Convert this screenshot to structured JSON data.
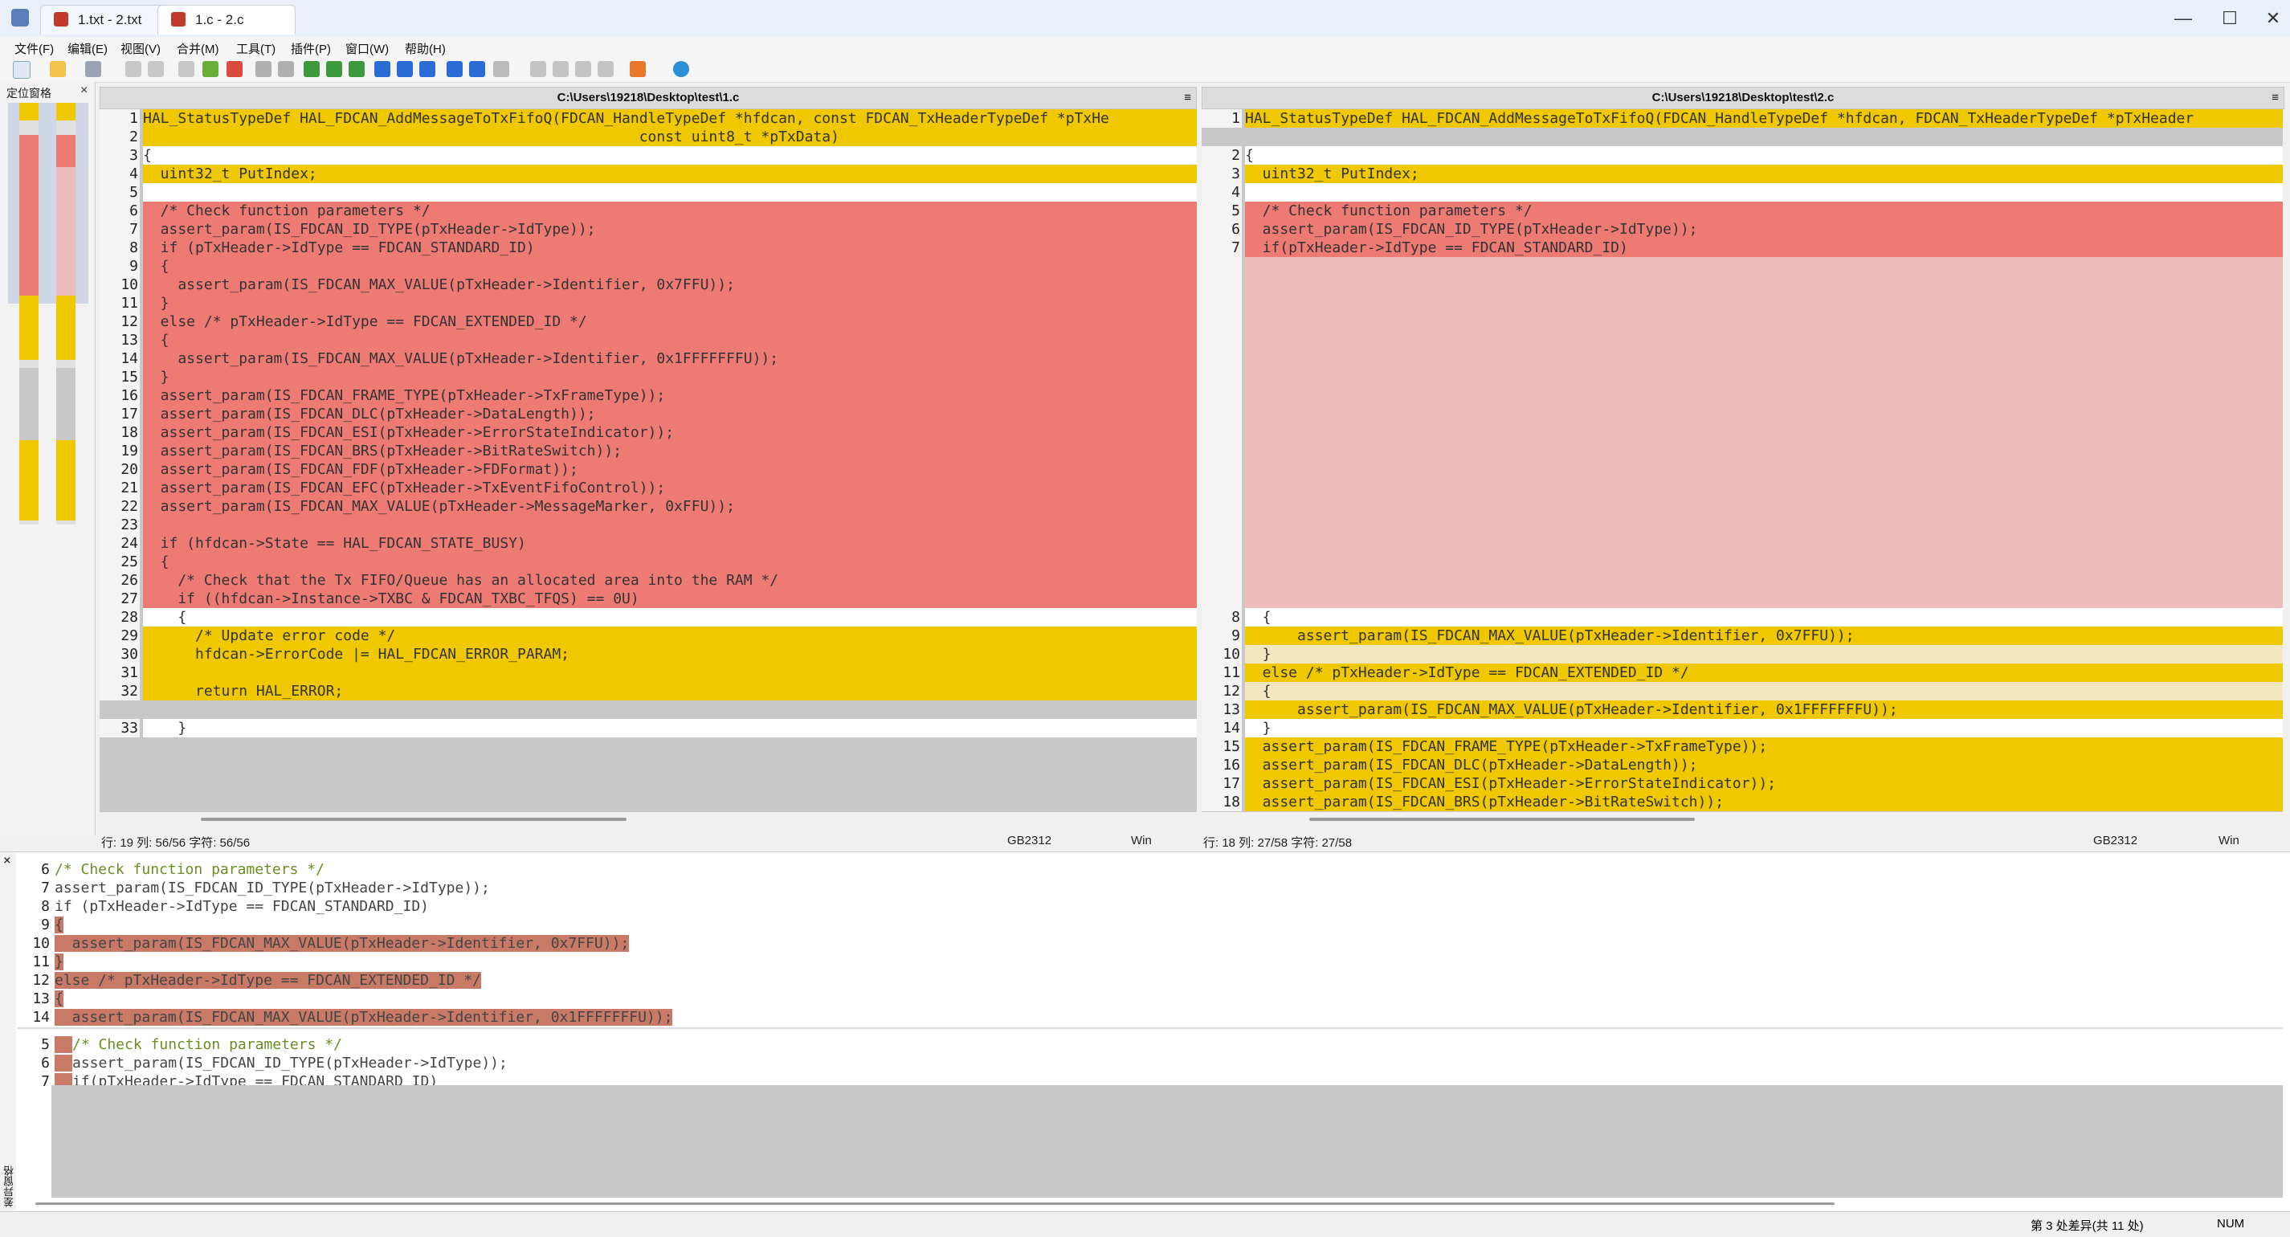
{
  "window": {
    "tabs": [
      {
        "label": "1.txt - 2.txt"
      },
      {
        "label": "1.c - 2.c"
      }
    ],
    "controls": [
      "—",
      "☐",
      "✕"
    ]
  },
  "menu": [
    "文件(F)",
    "编辑(E)",
    "视图(V)",
    "合并(M)",
    "工具(T)",
    "插件(P)",
    "窗口(W)",
    "帮助(H)"
  ],
  "locator": {
    "title": "定位窗格",
    "close": "×"
  },
  "left_pane": {
    "path": "C:\\Users\\19218\\Desktop\\test\\1.c",
    "menu_icon": "≡",
    "lines": [
      {
        "n": "1",
        "t": "HAL_StatusTypeDef HAL_FDCAN_AddMessageToTxFifoQ(FDCAN_HandleTypeDef *hfdcan, const FDCAN_TxHeaderTypeDef *pTxHe",
        "c": "yellow"
      },
      {
        "n": "2",
        "t": "                                                         const uint8_t *pTxData)",
        "c": "yellow"
      },
      {
        "n": "3",
        "t": "{",
        "c": "white"
      },
      {
        "n": "4",
        "t": "  uint32_t PutIndex;",
        "c": "yellow"
      },
      {
        "n": "5",
        "t": "",
        "c": "white"
      },
      {
        "n": "6",
        "t": "  /* Check function parameters */",
        "c": "red"
      },
      {
        "n": "7",
        "t": "  assert_param(IS_FDCAN_ID_TYPE(pTxHeader->IdType));",
        "c": "red"
      },
      {
        "n": "8",
        "t": "  if (pTxHeader->IdType == FDCAN_STANDARD_ID)",
        "c": "red"
      },
      {
        "n": "9",
        "t": "  {",
        "c": "red"
      },
      {
        "n": "10",
        "t": "    assert_param(IS_FDCAN_MAX_VALUE(pTxHeader->Identifier, 0x7FFU));",
        "c": "red"
      },
      {
        "n": "11",
        "t": "  }",
        "c": "red"
      },
      {
        "n": "12",
        "t": "  else /* pTxHeader->IdType == FDCAN_EXTENDED_ID */",
        "c": "red"
      },
      {
        "n": "13",
        "t": "  {",
        "c": "red"
      },
      {
        "n": "14",
        "t": "    assert_param(IS_FDCAN_MAX_VALUE(pTxHeader->Identifier, 0x1FFFFFFFU));",
        "c": "red"
      },
      {
        "n": "15",
        "t": "  }",
        "c": "red"
      },
      {
        "n": "16",
        "t": "  assert_param(IS_FDCAN_FRAME_TYPE(pTxHeader->TxFrameType));",
        "c": "red"
      },
      {
        "n": "17",
        "t": "  assert_param(IS_FDCAN_DLC(pTxHeader->DataLength));",
        "c": "red"
      },
      {
        "n": "18",
        "t": "  assert_param(IS_FDCAN_ESI(pTxHeader->ErrorStateIndicator));",
        "c": "red"
      },
      {
        "n": "19",
        "t": "  assert_param(IS_FDCAN_BRS(pTxHeader->BitRateSwitch));",
        "c": "red"
      },
      {
        "n": "20",
        "t": "  assert_param(IS_FDCAN_FDF(pTxHeader->FDFormat));",
        "c": "red"
      },
      {
        "n": "21",
        "t": "  assert_param(IS_FDCAN_EFC(pTxHeader->TxEventFifoControl));",
        "c": "red"
      },
      {
        "n": "22",
        "t": "  assert_param(IS_FDCAN_MAX_VALUE(pTxHeader->MessageMarker, 0xFFU));",
        "c": "red"
      },
      {
        "n": "23",
        "t": "",
        "c": "red"
      },
      {
        "n": "24",
        "t": "  if (hfdcan->State == HAL_FDCAN_STATE_BUSY)",
        "c": "red"
      },
      {
        "n": "25",
        "t": "  {",
        "c": "red"
      },
      {
        "n": "26",
        "t": "    /* Check that the Tx FIFO/Queue has an allocated area into the RAM */",
        "c": "red"
      },
      {
        "n": "27",
        "t": "    if ((hfdcan->Instance->TXBC & FDCAN_TXBC_TFQS) == 0U)",
        "c": "red"
      },
      {
        "n": "28",
        "t": "    {",
        "c": "white"
      },
      {
        "n": "29",
        "t": "      /* Update error code */",
        "c": "yellow"
      },
      {
        "n": "30",
        "t": "      hfdcan->ErrorCode |= HAL_FDCAN_ERROR_PARAM;",
        "c": "yellow"
      },
      {
        "n": "31",
        "t": "",
        "c": "yellow"
      },
      {
        "n": "32",
        "t": "      return HAL_ERROR;",
        "c": "yellow"
      },
      {
        "n": "",
        "t": "",
        "c": "gray"
      },
      {
        "n": "33",
        "t": "    }",
        "c": "white"
      }
    ],
    "status": {
      "pos": "行: 19  列: 56/56  字符: 56/56",
      "enc": "GB2312",
      "eol": "Win"
    }
  },
  "right_pane": {
    "path": "C:\\Users\\19218\\Desktop\\test\\2.c",
    "menu_icon": "≡",
    "lines": [
      {
        "n": "1",
        "t": "HAL_StatusTypeDef HAL_FDCAN_AddMessageToTxFifoQ(FDCAN_HandleTypeDef *hfdcan, FDCAN_TxHeaderTypeDef *pTxHeader",
        "c": "yellow"
      },
      {
        "n": "",
        "t": "",
        "c": "gray"
      },
      {
        "n": "2",
        "t": "{",
        "c": "white"
      },
      {
        "n": "3",
        "t": "  uint32_t PutIndex;",
        "c": "yellow"
      },
      {
        "n": "4",
        "t": "",
        "c": "white"
      },
      {
        "n": "5",
        "t": "  /* Check function parameters */",
        "c": "red"
      },
      {
        "n": "6",
        "t": "  assert_param(IS_FDCAN_ID_TYPE(pTxHeader->IdType));",
        "c": "red"
      },
      {
        "n": "7",
        "t": "  if(pTxHeader->IdType == FDCAN_STANDARD_ID)",
        "c": "red"
      },
      {
        "n": "",
        "t": "",
        "c": "pink"
      },
      {
        "n": "",
        "t": "",
        "c": "pink"
      },
      {
        "n": "",
        "t": "",
        "c": "pink"
      },
      {
        "n": "",
        "t": "",
        "c": "pink"
      },
      {
        "n": "",
        "t": "",
        "c": "pink"
      },
      {
        "n": "",
        "t": "",
        "c": "pink"
      },
      {
        "n": "",
        "t": "",
        "c": "pink"
      },
      {
        "n": "",
        "t": "",
        "c": "pink"
      },
      {
        "n": "",
        "t": "",
        "c": "pink"
      },
      {
        "n": "",
        "t": "",
        "c": "pink"
      },
      {
        "n": "",
        "t": "",
        "c": "pink"
      },
      {
        "n": "",
        "t": "",
        "c": "pink"
      },
      {
        "n": "",
        "t": "",
        "c": "pink"
      },
      {
        "n": "",
        "t": "",
        "c": "pink"
      },
      {
        "n": "",
        "t": "",
        "c": "pink"
      },
      {
        "n": "",
        "t": "",
        "c": "pink"
      },
      {
        "n": "",
        "t": "",
        "c": "pink"
      },
      {
        "n": "",
        "t": "",
        "c": "pink"
      },
      {
        "n": "",
        "t": "",
        "c": "pink"
      },
      {
        "n": "8",
        "t": "  {",
        "c": "white"
      },
      {
        "n": "9",
        "t": "      assert_param(IS_FDCAN_MAX_VALUE(pTxHeader->Identifier, 0x7FFU));",
        "c": "yellow"
      },
      {
        "n": "10",
        "t": "  }",
        "c": "cream"
      },
      {
        "n": "11",
        "t": "  else /* pTxHeader->IdType == FDCAN_EXTENDED_ID */",
        "c": "yellow"
      },
      {
        "n": "12",
        "t": "  {",
        "c": "cream"
      },
      {
        "n": "13",
        "t": "      assert_param(IS_FDCAN_MAX_VALUE(pTxHeader->Identifier, 0x1FFFFFFFU));",
        "c": "yellow"
      },
      {
        "n": "14",
        "t": "  }",
        "c": "white"
      },
      {
        "n": "15",
        "t": "  assert_param(IS_FDCAN_FRAME_TYPE(pTxHeader->TxFrameType));",
        "c": "yellow"
      },
      {
        "n": "16",
        "t": "  assert_param(IS_FDCAN_DLC(pTxHeader->DataLength));",
        "c": "yellow"
      },
      {
        "n": "17",
        "t": "  assert_param(IS_FDCAN_ESI(pTxHeader->ErrorStateIndicator));",
        "c": "yellow"
      },
      {
        "n": "18",
        "t": "  assert_param(IS_FDCAN_BRS(pTxHeader->BitRateSwitch));",
        "c": "yellow"
      }
    ],
    "status": {
      "pos": "行: 18  列: 27/58  字符: 27/58",
      "enc": "GB2312",
      "eol": "Win"
    }
  },
  "detail": {
    "close": "×",
    "side_label": "差异窗格",
    "top_lines": [
      {
        "n": "6",
        "t": "/* Check function parameters */"
      },
      {
        "n": "7",
        "t": "assert_param(IS_FDCAN_ID_TYPE(pTxHeader->IdType));"
      },
      {
        "n": "8",
        "t": "if (pTxHeader->IdType == FDCAN_STANDARD_ID)"
      },
      {
        "n": "9",
        "t": "{"
      },
      {
        "n": "10",
        "t": "  assert_param(IS_FDCAN_MAX_VALUE(pTxHeader->Identifier, 0x7FFU));"
      },
      {
        "n": "11",
        "t": "}"
      },
      {
        "n": "12",
        "t": "else /* pTxHeader->IdType == FDCAN_EXTENDED_ID */"
      },
      {
        "n": "13",
        "t": "{"
      },
      {
        "n": "14",
        "t": "  assert_param(IS_FDCAN_MAX_VALUE(pTxHeader->Identifier, 0x1FFFFFFFU));"
      }
    ],
    "bottom_lines": [
      {
        "n": "5",
        "t": "/* Check function parameters */"
      },
      {
        "n": "6",
        "t": "assert_param(IS_FDCAN_ID_TYPE(pTxHeader->IdType));"
      },
      {
        "n": "7",
        "t": "if(pTxHeader->IdType == FDCAN_STANDARD_ID)"
      }
    ]
  },
  "statusbar": {
    "diff_info": "第 3 处差异(共 11 处)",
    "num": "NUM"
  },
  "colors": {
    "added": "#f0c800",
    "removed": "#ee7a74",
    "placeholder": "#efbcbc",
    "changed_light": "#f3e7bf"
  }
}
